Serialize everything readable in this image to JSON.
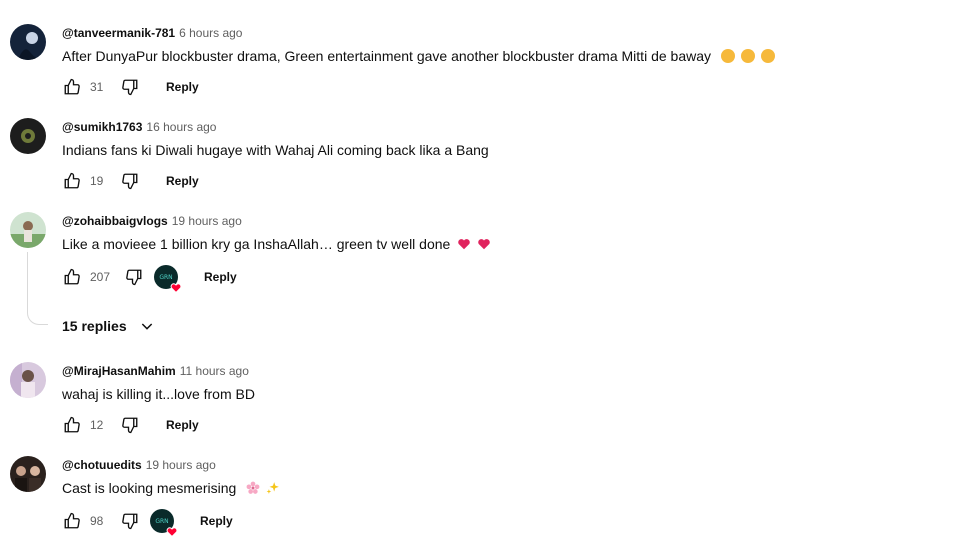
{
  "comments": [
    {
      "author": "@tanveermanik-781",
      "time": "6 hours ago",
      "text": "After DunyaPur blockbuster drama, Green entertainment gave another blockbuster drama Mitti de baway",
      "emojis": [
        "astonished-face-emoji",
        "astonished-face-emoji",
        "astonished-face-emoji"
      ],
      "likes": "31",
      "reply_label": "Reply"
    },
    {
      "author": "@sumikh1763",
      "time": "16 hours ago",
      "text": "Indians fans ki Diwali hugaye with Wahaj Ali coming back lika a Bang",
      "likes": "19",
      "reply_label": "Reply"
    },
    {
      "author": "@zohaibbaigvlogs",
      "time": "19 hours ago",
      "text": "Like a movieee 1 billion kry ga InshaAllah… green tv well done",
      "emojis": [
        "red-heart-emoji",
        "red-heart-emoji"
      ],
      "likes": "207",
      "reply_label": "Reply",
      "creator_hearted": true,
      "replies_label": "15 replies"
    },
    {
      "author": "@MirajHasanMahim",
      "time": "11 hours ago",
      "text": "wahaj is killing it...love from BD",
      "likes": "12",
      "reply_label": "Reply"
    },
    {
      "author": "@chotuuedits",
      "time": "19 hours ago",
      "text": "Cast is looking mesmerising",
      "emojis": [
        "cherry-blossom-emoji",
        "sparkles-emoji"
      ],
      "likes": "98",
      "reply_label": "Reply",
      "creator_hearted": true
    }
  ],
  "colors": {
    "text": "#0f0f0f",
    "secondary": "#606060",
    "heart": "#ff0033"
  },
  "icons": [
    "thumb-up-icon",
    "thumb-down-icon",
    "chevron-down-icon",
    "heart-icon"
  ]
}
